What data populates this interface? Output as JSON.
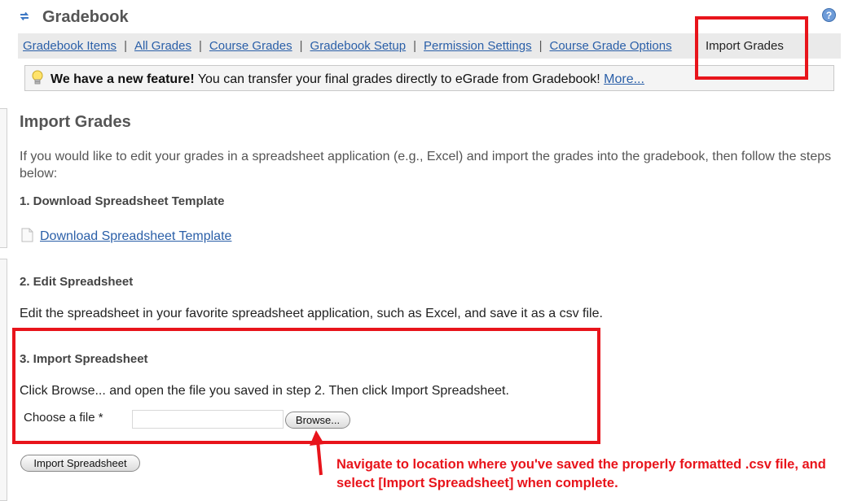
{
  "header": {
    "title": "Gradebook",
    "refresh_icon": "refresh-icon",
    "help_icon": "help-icon"
  },
  "nav": {
    "items": [
      {
        "label": "Gradebook Items"
      },
      {
        "label": "All Grades"
      },
      {
        "label": "Course Grades"
      },
      {
        "label": "Gradebook Setup"
      },
      {
        "label": "Permission Settings"
      },
      {
        "label": "Course Grade Options"
      }
    ],
    "separator": "|",
    "current": "Import Grades"
  },
  "notice": {
    "icon": "lightbulb-icon",
    "bold": "We have a new feature!",
    "text": " You can transfer your final grades directly to eGrade from Gradebook! ",
    "link": "More..."
  },
  "main": {
    "title": "Import Grades",
    "intro": "If you would like to edit your grades in a spreadsheet application (e.g., Excel) and import the grades into the gradebook, then follow the steps below:",
    "step1": {
      "heading": "1. Download Spreadsheet Template",
      "link": "Download Spreadsheet Template",
      "icon": "document-icon"
    },
    "step2": {
      "heading": "2. Edit Spreadsheet",
      "text": "Edit the spreadsheet in your favorite spreadsheet application, such as Excel, and save it as a csv file."
    },
    "step3": {
      "heading": "3. Import Spreadsheet",
      "text": "Click Browse... and open the file you saved in step 2. Then click Import Spreadsheet.",
      "file_label": "Choose a file *",
      "file_value": "",
      "browse_label": "Browse..."
    },
    "import_button": "Import Spreadsheet"
  },
  "annotation": {
    "text": "Navigate to location where you've saved the properly formatted .csv file, and select [Import Spreadsheet] when complete.",
    "color": "#e8141b"
  }
}
